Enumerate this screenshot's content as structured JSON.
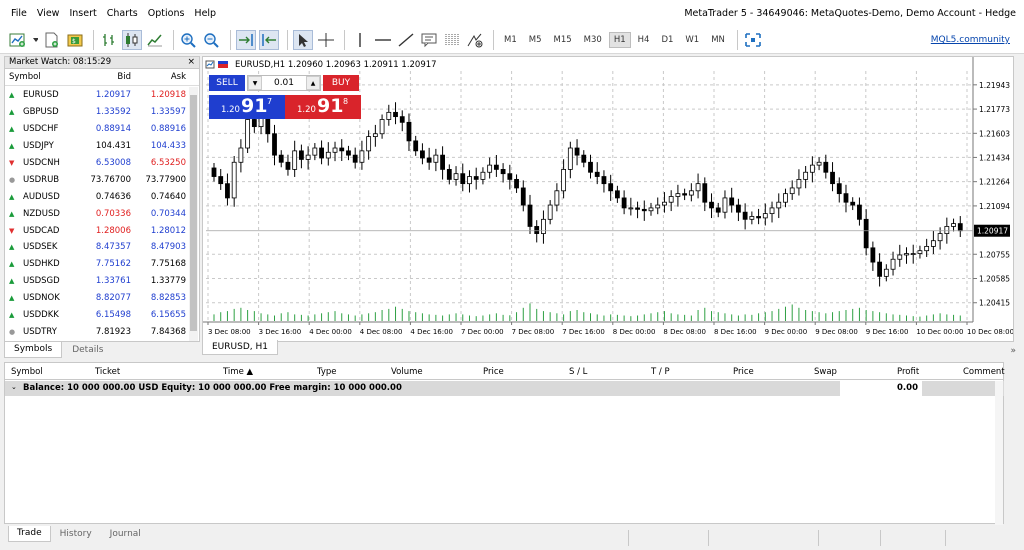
{
  "menu": {
    "items": [
      "File",
      "View",
      "Insert",
      "Charts",
      "Options",
      "Help"
    ]
  },
  "window_title": "MetaTrader 5 - 34649046: MetaQuotes-Demo, Demo Account - Hedge",
  "toolbar": {
    "icons": [
      "new-chart-icon",
      "dropdown-arrow-icon",
      "profiles-icon",
      "market-icon",
      "bar-chart-icon",
      "candlestick-icon",
      "line-chart-icon",
      "zoom-in-icon",
      "zoom-out-icon",
      "chart-shift-icon",
      "auto-scroll-icon",
      "cursor-icon",
      "crosshair-icon",
      "vertical-line-icon",
      "horizontal-line-icon",
      "trend-line-icon",
      "text-icon",
      "fibonacci-icon",
      "objects-icon"
    ],
    "timeframes": [
      "M1",
      "M5",
      "M15",
      "M30",
      "H1",
      "H4",
      "D1",
      "W1",
      "MN"
    ],
    "active_timeframe": "H1",
    "mql5_link": "MQL5.community"
  },
  "market_watch": {
    "title": "Market Watch: 08:15:29",
    "close": "×",
    "columns": {
      "symbol": "Symbol",
      "bid": "Bid",
      "ask": "Ask"
    },
    "rows": [
      {
        "symbol": "EURUSD",
        "bid": "1.20917",
        "ask": "1.20918",
        "dir": "up",
        "bid_color": "blue",
        "ask_color": "red"
      },
      {
        "symbol": "GBPUSD",
        "bid": "1.33592",
        "ask": "1.33597",
        "dir": "up",
        "bid_color": "blue",
        "ask_color": "blue"
      },
      {
        "symbol": "USDCHF",
        "bid": "0.88914",
        "ask": "0.88916",
        "dir": "up",
        "bid_color": "blue",
        "ask_color": "blue"
      },
      {
        "symbol": "USDJPY",
        "bid": "104.431",
        "ask": "104.433",
        "dir": "up",
        "bid_color": "black",
        "ask_color": "blue"
      },
      {
        "symbol": "USDCNH",
        "bid": "6.53008",
        "ask": "6.53250",
        "dir": "down",
        "bid_color": "blue",
        "ask_color": "red"
      },
      {
        "symbol": "USDRUB",
        "bid": "73.76700",
        "ask": "73.77900",
        "dir": "flat",
        "bid_color": "black",
        "ask_color": "black"
      },
      {
        "symbol": "AUDUSD",
        "bid": "0.74636",
        "ask": "0.74640",
        "dir": "up",
        "bid_color": "black",
        "ask_color": "black"
      },
      {
        "symbol": "NZDUSD",
        "bid": "0.70336",
        "ask": "0.70344",
        "dir": "up",
        "bid_color": "red",
        "ask_color": "blue"
      },
      {
        "symbol": "USDCAD",
        "bid": "1.28006",
        "ask": "1.28012",
        "dir": "down",
        "bid_color": "red",
        "ask_color": "blue"
      },
      {
        "symbol": "USDSEK",
        "bid": "8.47357",
        "ask": "8.47903",
        "dir": "up",
        "bid_color": "blue",
        "ask_color": "blue"
      },
      {
        "symbol": "USDHKD",
        "bid": "7.75162",
        "ask": "7.75168",
        "dir": "up",
        "bid_color": "blue",
        "ask_color": "black"
      },
      {
        "symbol": "USDSGD",
        "bid": "1.33761",
        "ask": "1.33779",
        "dir": "up",
        "bid_color": "blue",
        "ask_color": "black"
      },
      {
        "symbol": "USDNOK",
        "bid": "8.82077",
        "ask": "8.82853",
        "dir": "up",
        "bid_color": "blue",
        "ask_color": "blue"
      },
      {
        "symbol": "USDDKK",
        "bid": "6.15498",
        "ask": "6.15655",
        "dir": "up",
        "bid_color": "blue",
        "ask_color": "blue"
      },
      {
        "symbol": "USDTRY",
        "bid": "7.81923",
        "ask": "7.84368",
        "dir": "flat",
        "bid_color": "black",
        "ask_color": "black"
      }
    ],
    "tabs": [
      "Symbols",
      "Details"
    ],
    "active_tab": "Symbols"
  },
  "chart": {
    "header": "EURUSD,H1  1.20960 1.20963 1.20911 1.20917",
    "tab_label": "EURUSD, H1",
    "more_arrows": "»",
    "current_price_label": "1.20917",
    "trade_panel": {
      "sell_label": "SELL",
      "buy_label": "BUY",
      "lot": "0.01",
      "lot_down": "▼",
      "lot_up": "▲",
      "sell_price": {
        "prefix": "1.20",
        "big": "91",
        "small": "7"
      },
      "buy_price": {
        "prefix": "1.20",
        "big": "91",
        "small": "8"
      }
    }
  },
  "chart_data": {
    "type": "candlestick",
    "title": "",
    "ylim": [
      1.2028,
      1.2204
    ],
    "y_ticks": [
      "1.21943",
      "1.21773",
      "1.21603",
      "1.21434",
      "1.21264",
      "1.21094",
      "1.20755",
      "1.20585",
      "1.20415"
    ],
    "y_tick_values": [
      1.21943,
      1.21773,
      1.21603,
      1.21434,
      1.21264,
      1.21094,
      1.20755,
      1.20585,
      1.20415
    ],
    "x_ticks": [
      "3 Dec 08:00",
      "3 Dec 16:00",
      "4 Dec 00:00",
      "4 Dec 08:00",
      "4 Dec 16:00",
      "7 Dec 00:00",
      "7 Dec 08:00",
      "7 Dec 16:00",
      "8 Dec 00:00",
      "8 Dec 08:00",
      "8 Dec 16:00",
      "9 Dec 00:00",
      "9 Dec 08:00",
      "9 Dec 16:00",
      "10 Dec 00:00",
      "10 Dec 08:00"
    ],
    "grid": true,
    "closes": [
      1.213,
      1.2125,
      1.2115,
      1.214,
      1.215,
      1.217,
      1.2165,
      1.2175,
      1.216,
      1.2145,
      1.214,
      1.2135,
      1.2148,
      1.2142,
      1.2145,
      1.215,
      1.2143,
      1.2147,
      1.215,
      1.2148,
      1.2145,
      1.214,
      1.2148,
      1.2158,
      1.216,
      1.217,
      1.2175,
      1.2172,
      1.2168,
      1.2155,
      1.2148,
      1.2143,
      1.214,
      1.2145,
      1.2135,
      1.2128,
      1.2132,
      1.2125,
      1.213,
      1.2128,
      1.2133,
      1.2138,
      1.2135,
      1.2132,
      1.2128,
      1.2122,
      1.211,
      1.2095,
      1.209,
      1.21,
      1.211,
      1.212,
      1.2135,
      1.215,
      1.2145,
      1.214,
      1.2133,
      1.213,
      1.2125,
      1.212,
      1.2115,
      1.2108,
      1.2108,
      1.2107,
      1.2106,
      1.2108,
      1.211,
      1.2112,
      1.2116,
      1.2118,
      1.2117,
      1.212,
      1.2125,
      1.2112,
      1.2108,
      1.2105,
      1.2115,
      1.211,
      1.2105,
      1.21,
      1.2102,
      1.2101,
      1.2104,
      1.2108,
      1.2112,
      1.2118,
      1.2122,
      1.2128,
      1.2133,
      1.2138,
      1.214,
      1.2133,
      1.2125,
      1.2118,
      1.2112,
      1.211,
      1.21,
      1.208,
      1.207,
      1.206,
      1.2065,
      1.2072,
      1.2075,
      1.2076,
      1.2076,
      1.2078,
      1.2081,
      1.2085,
      1.209,
      1.2095,
      1.2097,
      1.2092
    ],
    "volumes": [
      0.3,
      0.4,
      0.45,
      0.55,
      0.6,
      0.5,
      0.45,
      0.35,
      0.3,
      0.25,
      0.35,
      0.4,
      0.3,
      0.28,
      0.25,
      0.3,
      0.35,
      0.4,
      0.45,
      0.35,
      0.3,
      0.25,
      0.3,
      0.35,
      0.4,
      0.5,
      0.55,
      0.65,
      0.55,
      0.45,
      0.4,
      0.35,
      0.3,
      0.28,
      0.25,
      0.3,
      0.35,
      0.3,
      0.25,
      0.22,
      0.25,
      0.3,
      0.35,
      0.28,
      0.26,
      0.4,
      0.6,
      0.8,
      0.55,
      0.45,
      0.4,
      0.35,
      0.3,
      0.45,
      0.5,
      0.4,
      0.35,
      0.3,
      0.25,
      0.3,
      0.28,
      0.25,
      0.22,
      0.25,
      0.3,
      0.35,
      0.4,
      0.45,
      0.35,
      0.3,
      0.28,
      0.25,
      0.5,
      0.6,
      0.45,
      0.4,
      0.35,
      0.3,
      0.25,
      0.3,
      0.28,
      0.35,
      0.4,
      0.45,
      0.55,
      0.65,
      0.75,
      0.6,
      0.5,
      0.45,
      0.4,
      0.35,
      0.4,
      0.45,
      0.5,
      0.55,
      0.6,
      0.5,
      0.45,
      0.4,
      0.35,
      0.3,
      0.28,
      0.25,
      0.22,
      0.2,
      0.25,
      0.3,
      0.35,
      0.3,
      0.28,
      0.25
    ]
  },
  "terminal": {
    "columns": [
      "Symbol",
      "Ticket",
      "Time ▲",
      "Type",
      "Volume",
      "Price",
      "S / L",
      "T / P",
      "Price",
      "Swap",
      "Profit",
      "Comment"
    ],
    "balance_line": "Balance: 10 000 000.00 USD  Equity: 10 000 000.00  Free margin: 10 000 000.00",
    "profit": "0.00",
    "tabs": [
      "Trade",
      "History",
      "Journal"
    ],
    "active_tab": "Trade"
  }
}
